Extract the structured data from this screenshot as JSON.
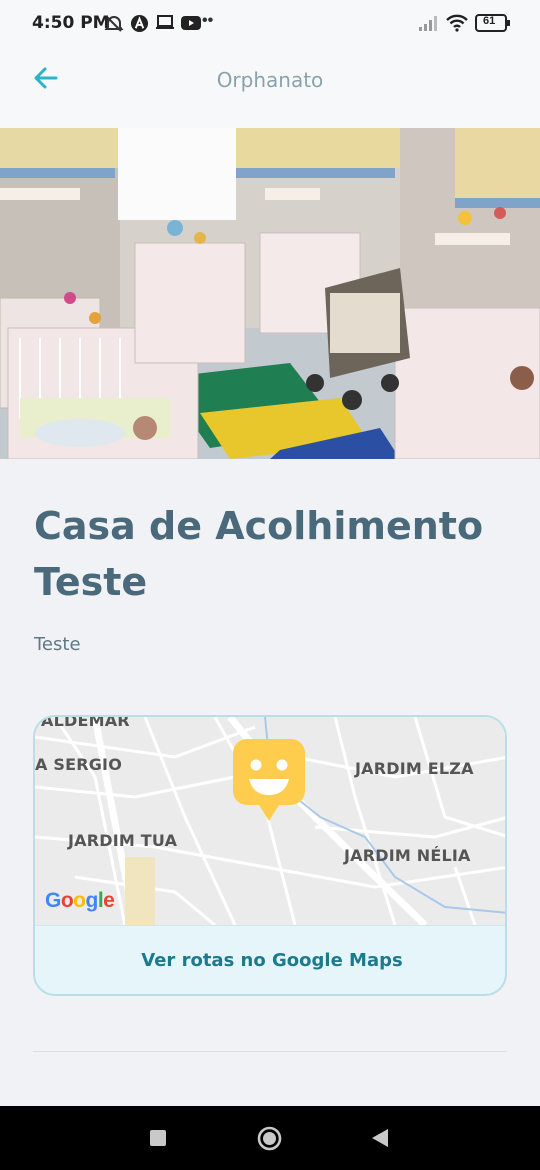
{
  "status_bar": {
    "time": "4:50 PM",
    "battery": "61",
    "icons": [
      "alarm-off-icon",
      "app-a-icon",
      "laptop-icon",
      "youtube-icon",
      "more-dots-icon",
      "signal-icon",
      "wifi-icon",
      "battery-icon"
    ]
  },
  "header": {
    "title": "Orphanato",
    "back_icon": "arrow-left-icon"
  },
  "hero": {
    "description": "photo of nursery room with cribs"
  },
  "content": {
    "title": "Casa de Acolhimento Teste",
    "description": "Teste"
  },
  "map": {
    "labels": {
      "waldemar": "ALDEMAR",
      "sergio": "A SERGIO",
      "jardim_elza": "JARDIM ELZA",
      "jardim_tua": "JARDIM TUA",
      "jardim_nelia": "JARDIM NÉLIA"
    },
    "google": [
      "G",
      "o",
      "o",
      "g",
      "l",
      "e"
    ],
    "directions_label": "Ver rotas no Google Maps"
  },
  "colors": {
    "accent": "#2ab4cc",
    "title": "#4a6a7c",
    "marker": "#ffcd4d"
  },
  "nav_bar": {
    "icons": [
      "recents-square-icon",
      "home-circle-icon",
      "back-triangle-icon"
    ]
  }
}
